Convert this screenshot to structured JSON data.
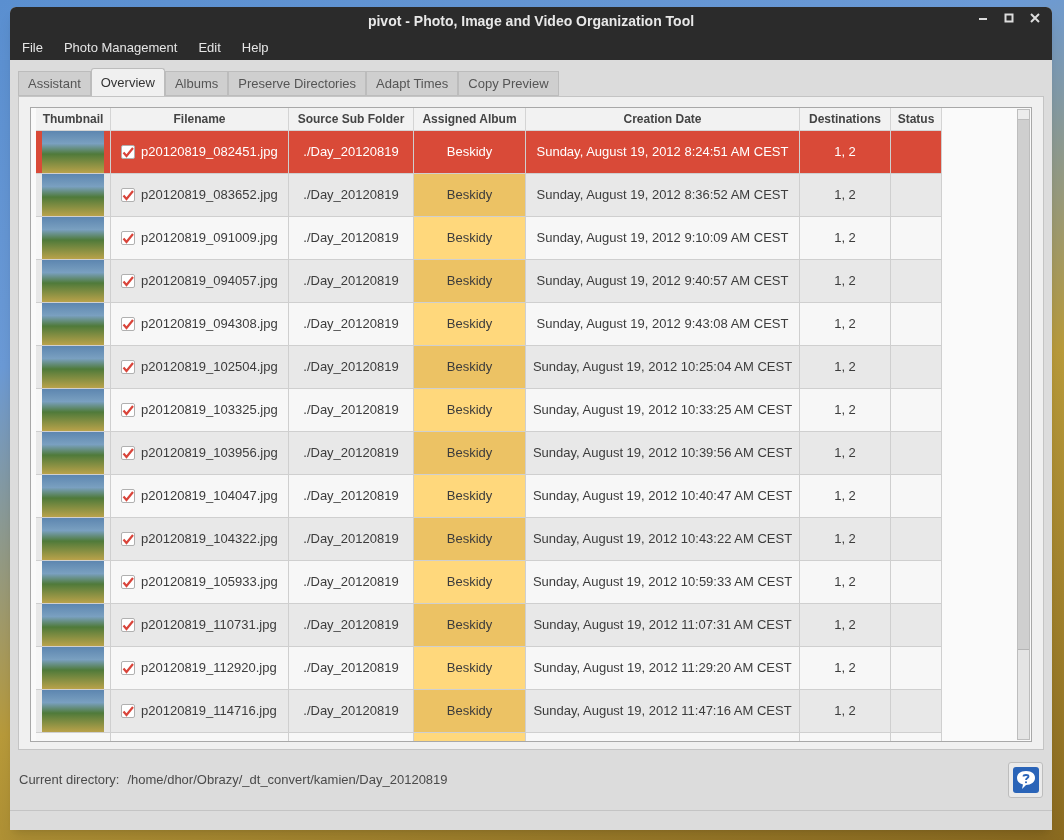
{
  "window": {
    "title": "pivot - Photo, Image and Video Organization Tool"
  },
  "menu": [
    "File",
    "Photo Management",
    "Edit",
    "Help"
  ],
  "tabs": [
    {
      "label": "Assistant",
      "selected": false
    },
    {
      "label": "Overview",
      "selected": true
    },
    {
      "label": "Albums",
      "selected": false
    },
    {
      "label": "Preserve Directories",
      "selected": false
    },
    {
      "label": "Adapt Times",
      "selected": false
    },
    {
      "label": "Copy Preview",
      "selected": false
    }
  ],
  "table": {
    "columns": [
      "Thumbnail",
      "Filename",
      "Source Sub Folder",
      "Assigned Album",
      "Creation Date",
      "Destinations",
      "Status"
    ],
    "rows": [
      {
        "selected": true,
        "checked": true,
        "filename": "p20120819_082451.jpg",
        "folder": "./Day_20120819",
        "album": "Beskidy",
        "date": "Sunday, August 19, 2012 8:24:51 AM CEST",
        "destinations": "1, 2"
      },
      {
        "selected": false,
        "checked": true,
        "filename": "p20120819_083652.jpg",
        "folder": "./Day_20120819",
        "album": "Beskidy",
        "date": "Sunday, August 19, 2012 8:36:52 AM CEST",
        "destinations": "1, 2"
      },
      {
        "selected": false,
        "checked": true,
        "filename": "p20120819_091009.jpg",
        "folder": "./Day_20120819",
        "album": "Beskidy",
        "date": "Sunday, August 19, 2012 9:10:09 AM CEST",
        "destinations": "1, 2"
      },
      {
        "selected": false,
        "checked": true,
        "filename": "p20120819_094057.jpg",
        "folder": "./Day_20120819",
        "album": "Beskidy",
        "date": "Sunday, August 19, 2012 9:40:57 AM CEST",
        "destinations": "1, 2"
      },
      {
        "selected": false,
        "checked": true,
        "filename": "p20120819_094308.jpg",
        "folder": "./Day_20120819",
        "album": "Beskidy",
        "date": "Sunday, August 19, 2012 9:43:08 AM CEST",
        "destinations": "1, 2"
      },
      {
        "selected": false,
        "checked": true,
        "filename": "p20120819_102504.jpg",
        "folder": "./Day_20120819",
        "album": "Beskidy",
        "date": "Sunday, August 19, 2012 10:25:04 AM CEST",
        "destinations": "1, 2"
      },
      {
        "selected": false,
        "checked": true,
        "filename": "p20120819_103325.jpg",
        "folder": "./Day_20120819",
        "album": "Beskidy",
        "date": "Sunday, August 19, 2012 10:33:25 AM CEST",
        "destinations": "1, 2"
      },
      {
        "selected": false,
        "checked": true,
        "filename": "p20120819_103956.jpg",
        "folder": "./Day_20120819",
        "album": "Beskidy",
        "date": "Sunday, August 19, 2012 10:39:56 AM CEST",
        "destinations": "1, 2"
      },
      {
        "selected": false,
        "checked": true,
        "filename": "p20120819_104047.jpg",
        "folder": "./Day_20120819",
        "album": "Beskidy",
        "date": "Sunday, August 19, 2012 10:40:47 AM CEST",
        "destinations": "1, 2"
      },
      {
        "selected": false,
        "checked": true,
        "filename": "p20120819_104322.jpg",
        "folder": "./Day_20120819",
        "album": "Beskidy",
        "date": "Sunday, August 19, 2012 10:43:22 AM CEST",
        "destinations": "1, 2"
      },
      {
        "selected": false,
        "checked": true,
        "filename": "p20120819_105933.jpg",
        "folder": "./Day_20120819",
        "album": "Beskidy",
        "date": "Sunday, August 19, 2012 10:59:33 AM CEST",
        "destinations": "1, 2"
      },
      {
        "selected": false,
        "checked": true,
        "filename": "p20120819_110731.jpg",
        "folder": "./Day_20120819",
        "album": "Beskidy",
        "date": "Sunday, August 19, 2012 11:07:31 AM CEST",
        "destinations": "1, 2"
      },
      {
        "selected": false,
        "checked": true,
        "filename": "p20120819_112920.jpg",
        "folder": "./Day_20120819",
        "album": "Beskidy",
        "date": "Sunday, August 19, 2012 11:29:20 AM CEST",
        "destinations": "1, 2"
      },
      {
        "selected": false,
        "checked": true,
        "filename": "p20120819_114716.jpg",
        "folder": "./Day_20120819",
        "album": "Beskidy",
        "date": "Sunday, August 19, 2012 11:47:16 AM CEST",
        "destinations": "1, 2"
      }
    ]
  },
  "status": {
    "label": "Current directory:",
    "path": "/home/dhor/Obrazy/_dt_convert/kamien/Day_20120819"
  }
}
